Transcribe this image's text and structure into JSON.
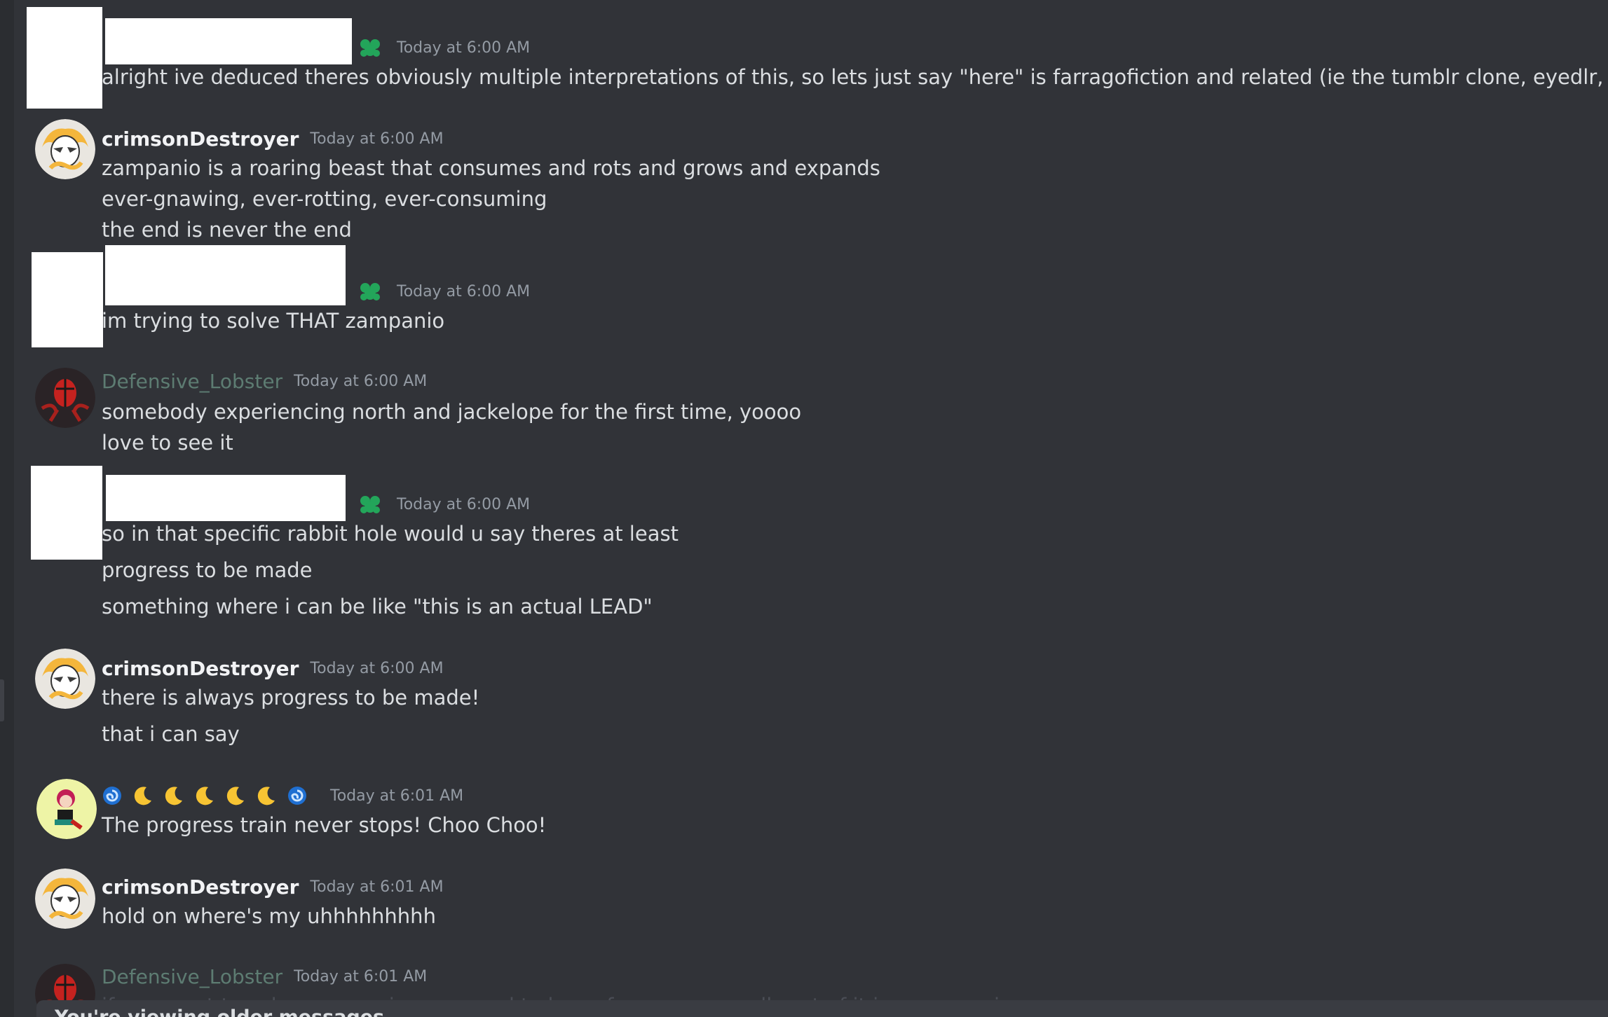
{
  "messages": [
    {
      "author": "",
      "timestamp": "Today at 6:00 AM",
      "lines": [
        "alright ive deduced theres obviously multiple interpretations of this, so lets just say \"here\" is farragofiction and related (ie the tumblr clone, eyedlr, etc)"
      ]
    },
    {
      "author": "crimsonDestroyer",
      "timestamp": "Today at 6:00 AM",
      "lines": [
        "zampanio is a roaring beast that consumes and rots and grows and expands",
        "ever-gnawing, ever-rotting, ever-consuming",
        "the end is never the end"
      ]
    },
    {
      "author": "",
      "timestamp": "Today at 6:00 AM",
      "lines": [
        "im trying to solve THAT zampanio"
      ]
    },
    {
      "author": "Defensive_Lobster",
      "timestamp": "Today at 6:00 AM",
      "lines": [
        "somebody experiencing north and jackelope for the first time, yoooo",
        "love to see it"
      ]
    },
    {
      "author": "",
      "timestamp": "Today at 6:00 AM",
      "lines": [
        "so in that specific rabbit hole would u say theres at least",
        "progress to be made",
        "something where i can be like \"this is an actual LEAD\""
      ]
    },
    {
      "author": "crimsonDestroyer",
      "timestamp": "Today at 6:00 AM",
      "lines": [
        "there is always progress to be made!",
        "that i can say"
      ]
    },
    {
      "author": "",
      "timestamp": "Today at 6:01 AM",
      "lines": [
        "The progress train never stops! Choo Choo!"
      ]
    },
    {
      "author": "crimsonDestroyer",
      "timestamp": "Today at 6:01 AM",
      "lines": [
        "hold on where's my uhhhhhhhhh"
      ]
    },
    {
      "author": "Defensive_Lobster",
      "timestamp": "Today at 6:01 AM",
      "lines": [
        "if you want to solve zampanio, you need to hyperfocus on a small part of it in my experience"
      ]
    }
  ],
  "banner": {
    "text": "You're viewing older messages"
  },
  "colors": {
    "background": "#313338",
    "username": "#f2f3f5",
    "muted_username": "#5d7c72",
    "timestamp": "#949ba4",
    "text": "#dbdee1",
    "role_icon": "#23a55a"
  },
  "icons": {
    "role": "clover-role-icon",
    "emoji_name": [
      "spiral-emoji",
      "crescent-moon-emoji",
      "crescent-moon-emoji",
      "crescent-moon-emoji",
      "crescent-moon-emoji",
      "crescent-moon-emoji",
      "spiral-emoji"
    ]
  }
}
